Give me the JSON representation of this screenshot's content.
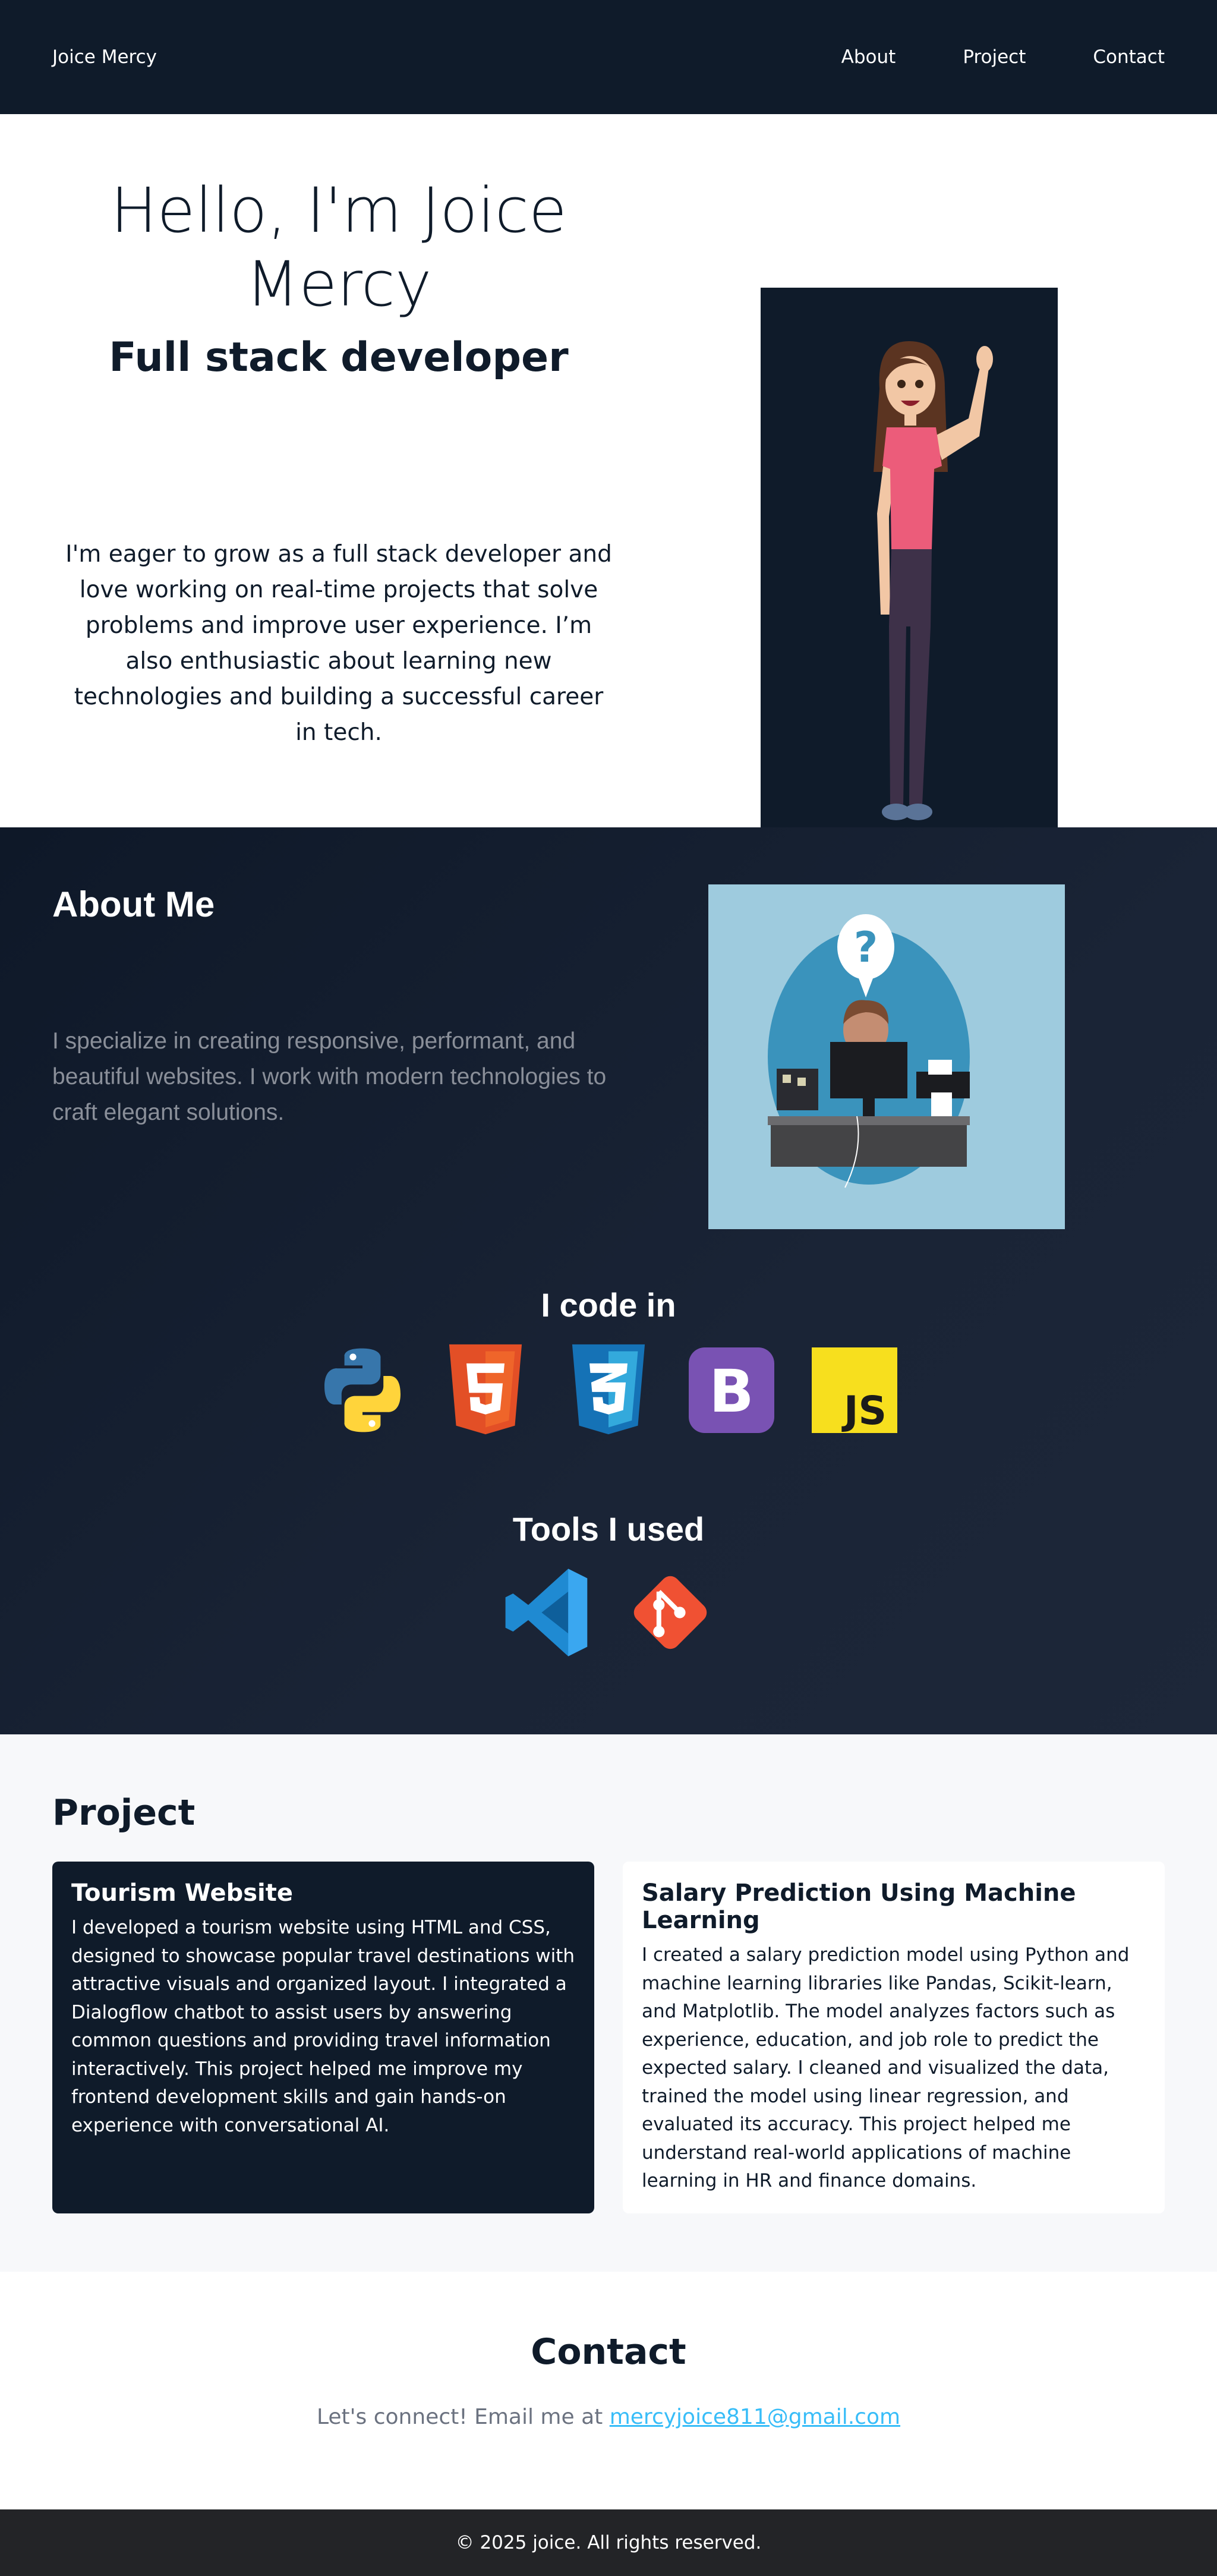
{
  "nav": {
    "brand": "Joice Mercy",
    "links": [
      {
        "label": "About"
      },
      {
        "label": "Project"
      },
      {
        "label": "Contact"
      }
    ]
  },
  "hero": {
    "title": "Hello, I'm Joice Mercy",
    "subtitle": "Full stack developer",
    "description": "I'm eager to grow as a full stack developer and love working on real-time projects that solve problems and improve user experience. I’m also enthusiastic about learning new technologies and building a successful career in tech.",
    "portrait_icon": "waving-woman-illustration"
  },
  "about": {
    "title": "About Me",
    "description": "I specialize in creating responsive, performant, and beautiful websites. I work with modern technologies to craft elegant solutions.",
    "illustration_icon": "developer-at-desk-illustration",
    "code_title": "I code in",
    "code_icons": [
      "python-icon",
      "html5-icon",
      "css3-icon",
      "bootstrap-icon",
      "javascript-icon"
    ],
    "tools_title": "Tools I used",
    "tool_icons": [
      "vscode-icon",
      "git-icon"
    ]
  },
  "projects": {
    "title": "Project",
    "items": [
      {
        "title": "Tourism Website",
        "description": "I developed a tourism website using HTML and CSS, designed to showcase popular travel destinations with attractive visuals and organized layout. I integrated a Dialogflow chatbot to assist users by answering common questions and providing travel information interactively. This project helped me improve my frontend development skills and gain hands-on experience with conversational AI."
      },
      {
        "title": "Salary Prediction Using Machine Learning",
        "description": "I created a salary prediction model using Python and machine learning libraries like Pandas, Scikit-learn, and Matplotlib. The model analyzes factors such as experience, education, and job role to predict the expected salary. I cleaned and visualized the data, trained the model using linear regression, and evaluated its accuracy. This project helped me understand real-world applications of machine learning in HR and finance domains."
      }
    ]
  },
  "contact": {
    "title": "Contact",
    "text": "Let's connect! Email me at",
    "email": "mercyjoice811@gmail.com"
  },
  "footer": {
    "text": "© 2025 joice. All rights reserved."
  },
  "colors": {
    "navy": "#0f1b2a",
    "link_accent": "#38bdf8",
    "muted_text": "#8a8f99"
  }
}
